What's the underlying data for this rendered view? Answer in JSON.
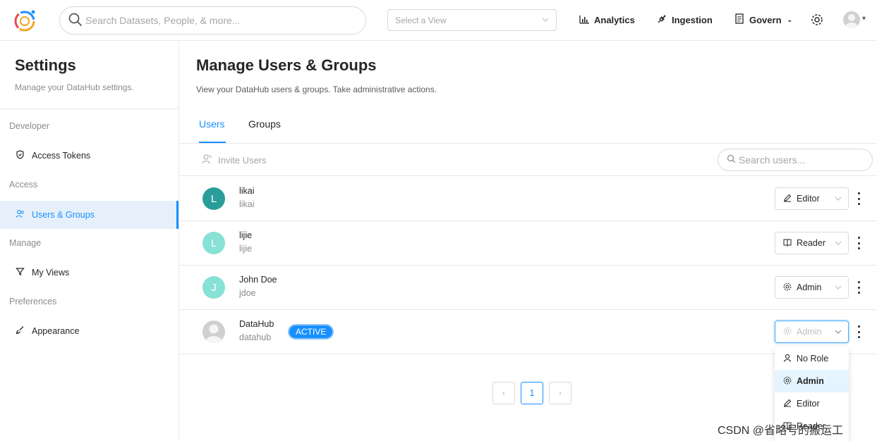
{
  "header": {
    "search_placeholder": "Search Datasets, People, & more...",
    "view_select_placeholder": "Select a View",
    "nav": {
      "analytics": "Analytics",
      "ingestion": "Ingestion",
      "govern": "Govern"
    }
  },
  "sidebar": {
    "title": "Settings",
    "subtitle": "Manage your DataHub settings.",
    "sections": {
      "developer": "Developer",
      "access": "Access",
      "manage": "Manage",
      "preferences": "Preferences"
    },
    "items": {
      "access_tokens": "Access Tokens",
      "users_groups": "Users & Groups",
      "my_views": "My Views",
      "appearance": "Appearance"
    }
  },
  "main": {
    "title": "Manage Users & Groups",
    "subtitle": "View your DataHub users & groups. Take administrative actions.",
    "tabs": [
      {
        "label": "Users",
        "active": true
      },
      {
        "label": "Groups",
        "active": false
      }
    ],
    "invite_label": "Invite Users",
    "user_search_placeholder": "Search users...",
    "users": [
      {
        "initial": "L",
        "name": "likai",
        "handle": "likai",
        "role": "Editor",
        "role_icon": "pencil-icon",
        "avatar_color": "#2a9d9a"
      },
      {
        "initial": "L",
        "name": "lijie",
        "handle": "lijie",
        "role": "Reader",
        "role_icon": "book-icon",
        "avatar_color": "#87e1d5"
      },
      {
        "initial": "J",
        "name": "John Doe",
        "handle": "jdoe",
        "role": "Admin",
        "role_icon": "gear-icon",
        "avatar_color": "#87e1d5"
      },
      {
        "initial": "",
        "name": "DataHub",
        "handle": "datahub",
        "badge": "ACTIVE",
        "role": "Admin",
        "role_icon": "gear-icon",
        "avatar_color": "#d0d0d0"
      }
    ],
    "role_dropdown": {
      "options": [
        {
          "label": "No Role",
          "icon": "user-icon"
        },
        {
          "label": "Admin",
          "icon": "gear-icon",
          "selected": true
        },
        {
          "label": "Editor",
          "icon": "pencil-icon"
        },
        {
          "label": "Reader",
          "icon": "book-icon"
        }
      ]
    },
    "pagination": {
      "prev": "‹",
      "current": "1",
      "next": "›"
    }
  },
  "watermark": "CSDN @省略号的搬运工"
}
